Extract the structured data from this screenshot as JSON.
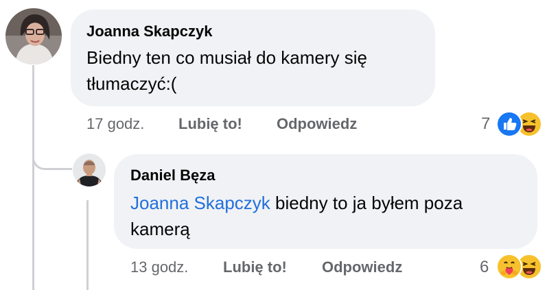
{
  "comments": [
    {
      "author": "Joanna Skapczyk",
      "text_line1": "Biedny ten co musiał do kamery się",
      "text_line2": "tłumaczyć:(",
      "time": "17 godz.",
      "like_label": "Lubię to!",
      "reply_label": "Odpowiedz",
      "reaction_count": "7",
      "reactions": [
        "like-icon",
        "laugh-icon"
      ]
    }
  ],
  "replies": [
    {
      "author": "Daniel Bęza",
      "mention": "Joanna Skapczyk",
      "text_line1_rest": " biedny to ja byłem poza",
      "text_line2": "kamerą",
      "time": "13 godz.",
      "like_label": "Lubię to!",
      "reply_label": "Odpowiedz",
      "reaction_count": "6",
      "reactions": [
        "care-icon",
        "laugh-icon"
      ]
    }
  ],
  "colors": {
    "bubble": "#f0f2f5",
    "meta_text": "#65676b",
    "mention": "#216fdb",
    "like_blue": "#1877f2",
    "emoji_yellow": "#f7c12d"
  }
}
